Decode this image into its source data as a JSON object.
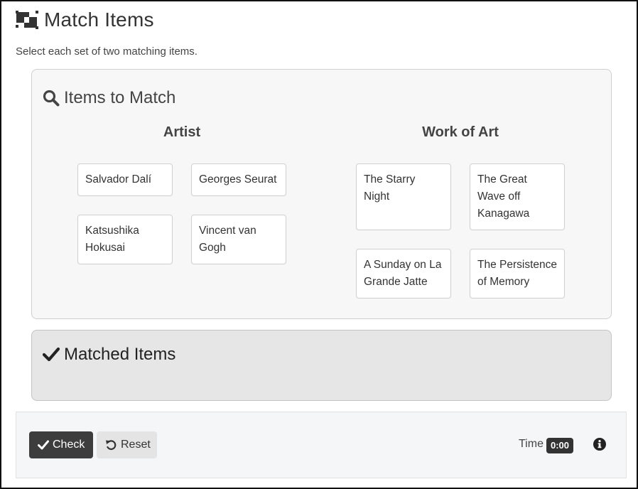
{
  "header": {
    "title": "Match Items",
    "title_icon": "match-items-icon",
    "instructions": "Select each set of two matching items."
  },
  "items_panel": {
    "heading": "Items to Match",
    "heading_icon": "search-icon",
    "columns": [
      {
        "title": "Artist",
        "items": [
          "Salvador Dalí",
          "Georges Seurat",
          "Katsushika Hokusai",
          "Vincent van Gogh"
        ]
      },
      {
        "title": "Work of Art",
        "items": [
          "The Starry Night",
          "The Great Wave off Kanagawa",
          "A Sunday on La Grande Jatte",
          "The Persistence of Memory"
        ]
      }
    ]
  },
  "matched_panel": {
    "heading": "Matched Items",
    "heading_icon": "check-icon"
  },
  "footer": {
    "check_label": "Check",
    "reset_label": "Reset",
    "time_label": "Time",
    "time_value": "0:00",
    "info_icon": "info-icon"
  },
  "colors": {
    "panel_bg": "#f7f7f7",
    "matched_bg": "#e6e6e6",
    "check_button_bg": "#3d3d3d",
    "reset_button_bg": "#e4e4e4"
  }
}
